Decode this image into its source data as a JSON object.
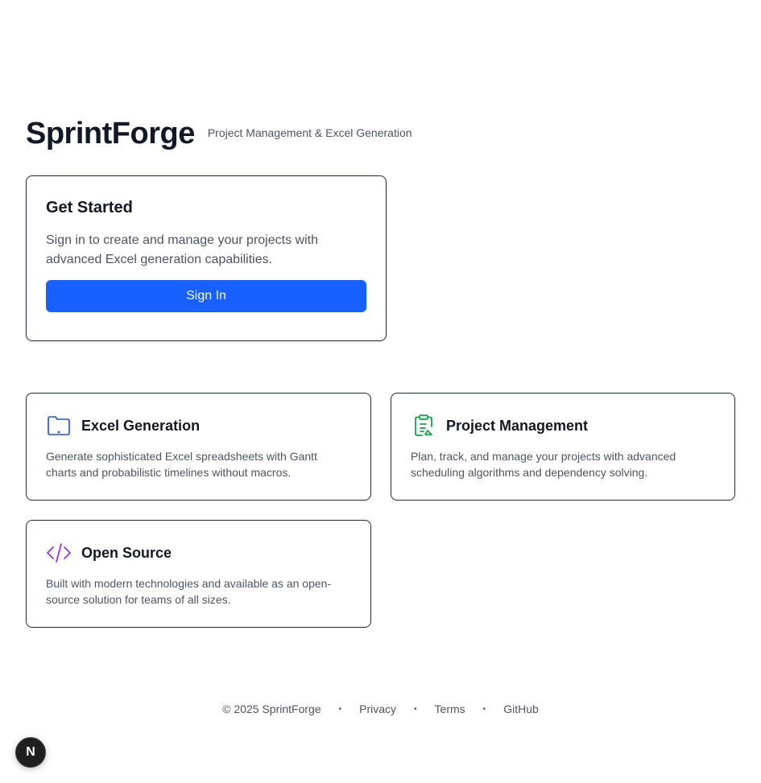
{
  "header": {
    "brand": "SprintForge",
    "tagline": "Project Management & Excel Generation"
  },
  "get_started": {
    "title": "Get Started",
    "description": "Sign in to create and manage your projects with advanced Excel generation capabilities.",
    "button_label": "Sign In"
  },
  "features": [
    {
      "icon": "folder-icon",
      "title": "Excel Generation",
      "description": "Generate sophisticated Excel spreadsheets with Gantt charts and probabilistic timelines without macros."
    },
    {
      "icon": "clipboard-icon",
      "title": "Project Management",
      "description": "Plan, track, and manage your projects with advanced scheduling algorithms and dependency solving."
    },
    {
      "icon": "code-icon",
      "title": "Open Source",
      "description": "Built with modern technologies and available as an open-source solution for teams of all sizes."
    }
  ],
  "footer": {
    "copyright": "© 2025 SprintForge",
    "separator": "•",
    "links": [
      "Privacy",
      "Terms",
      "GitHub"
    ]
  },
  "dev_badge": {
    "label": "N",
    "icon": "nextjs-icon"
  },
  "colors": {
    "primary": "#1860ff",
    "folder_icon": "#1d4ed8",
    "clipboard_icon": "#16a34a",
    "code_icon": "#9333ea",
    "text": "#111827",
    "muted": "#4b5563"
  }
}
